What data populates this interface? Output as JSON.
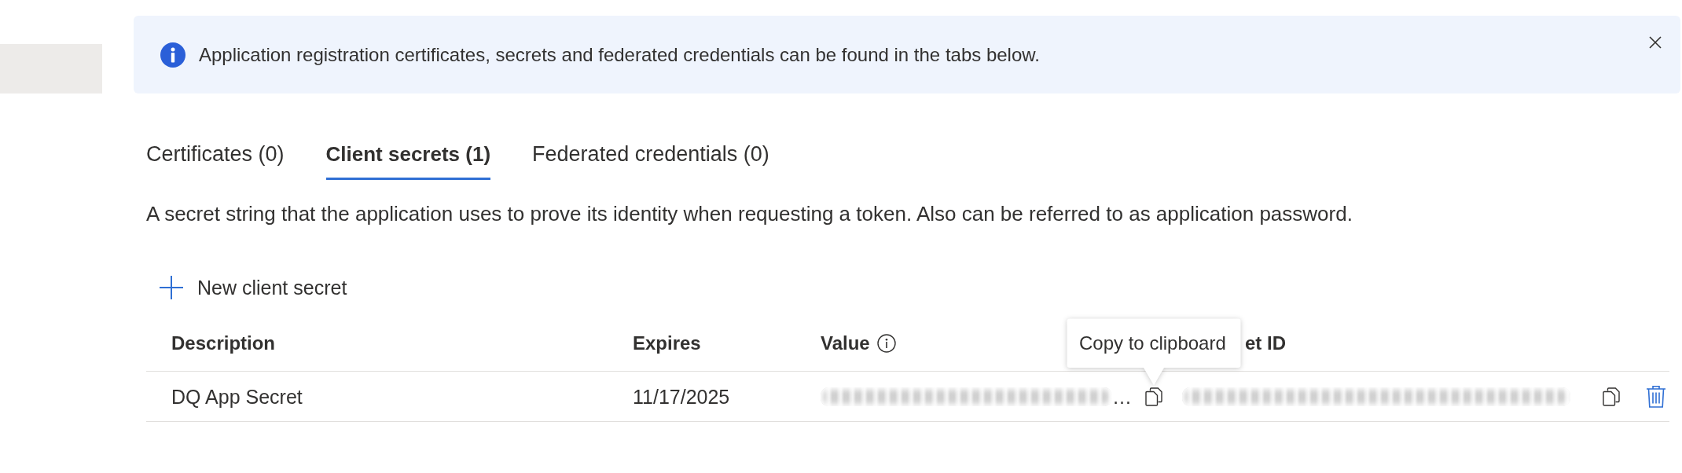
{
  "banner": {
    "message": "Application registration certificates, secrets and federated credentials can be found in the tabs below."
  },
  "tabs": [
    {
      "label": "Certificates (0)",
      "selected": false
    },
    {
      "label": "Client secrets (1)",
      "selected": true
    },
    {
      "label": "Federated credentials (0)",
      "selected": false
    }
  ],
  "description": "A secret string that the application uses to prove its identity when requesting a token. Also can be referred to as application password.",
  "toolbar": {
    "new_label": "New client secret"
  },
  "table": {
    "columns": [
      {
        "label": "Description",
        "info": false
      },
      {
        "label": "Expires",
        "info": false
      },
      {
        "label": "Value",
        "info": true
      },
      {
        "label": "et ID",
        "info": false
      }
    ],
    "rows": [
      {
        "description": "DQ App Secret",
        "expires": "11/17/2025",
        "value_ellipsis": "…"
      }
    ]
  },
  "tooltip": {
    "text": "Copy to clipboard"
  }
}
